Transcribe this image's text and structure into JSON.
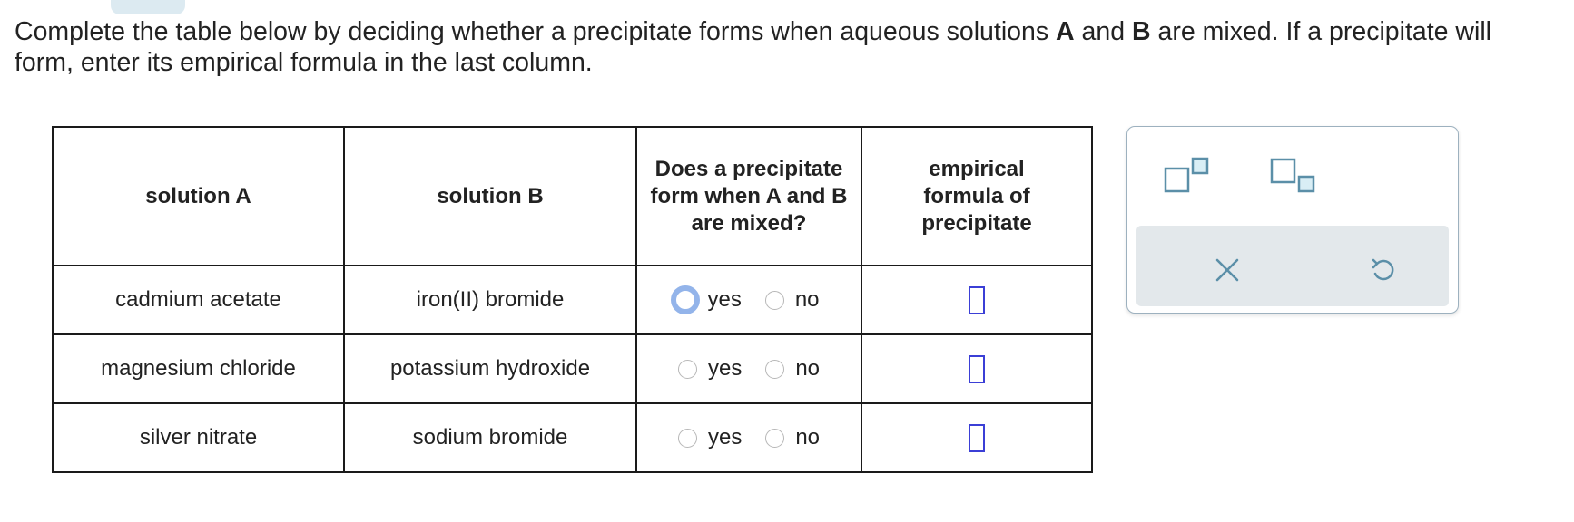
{
  "prompt": {
    "part1": "Complete the table below by deciding whether a precipitate forms when aqueous solutions ",
    "bold_a": "A",
    "part2": " and ",
    "bold_b": "B",
    "part3": " are mixed. If a precipitate will form, enter its empirical formula in the last column."
  },
  "table": {
    "headers": {
      "solution_a": "solution A",
      "solution_b": "solution B",
      "precipitate_question": "Does a precipitate form when A and B are mixed?",
      "empirical_formula": "empirical formula of precipitate"
    },
    "rows": [
      {
        "solution_a": "cadmium acetate",
        "solution_b": "iron(II) bromide",
        "yes": "yes",
        "no": "no"
      },
      {
        "solution_a": "magnesium chloride",
        "solution_b": "potassium hydroxide",
        "yes": "yes",
        "no": "no"
      },
      {
        "solution_a": "silver nitrate",
        "solution_b": "sodium bromide",
        "yes": "yes",
        "no": "no"
      }
    ]
  },
  "palette": {
    "icons": [
      "superscript-icon",
      "subscript-icon",
      "clear-icon",
      "undo-icon"
    ]
  },
  "colors": {
    "answer_box_border": "#3b3fd6",
    "palette_icon": "#5b8fa8",
    "focus_ring": "#93b4ea",
    "palette_bar": "#e3e8eb"
  }
}
